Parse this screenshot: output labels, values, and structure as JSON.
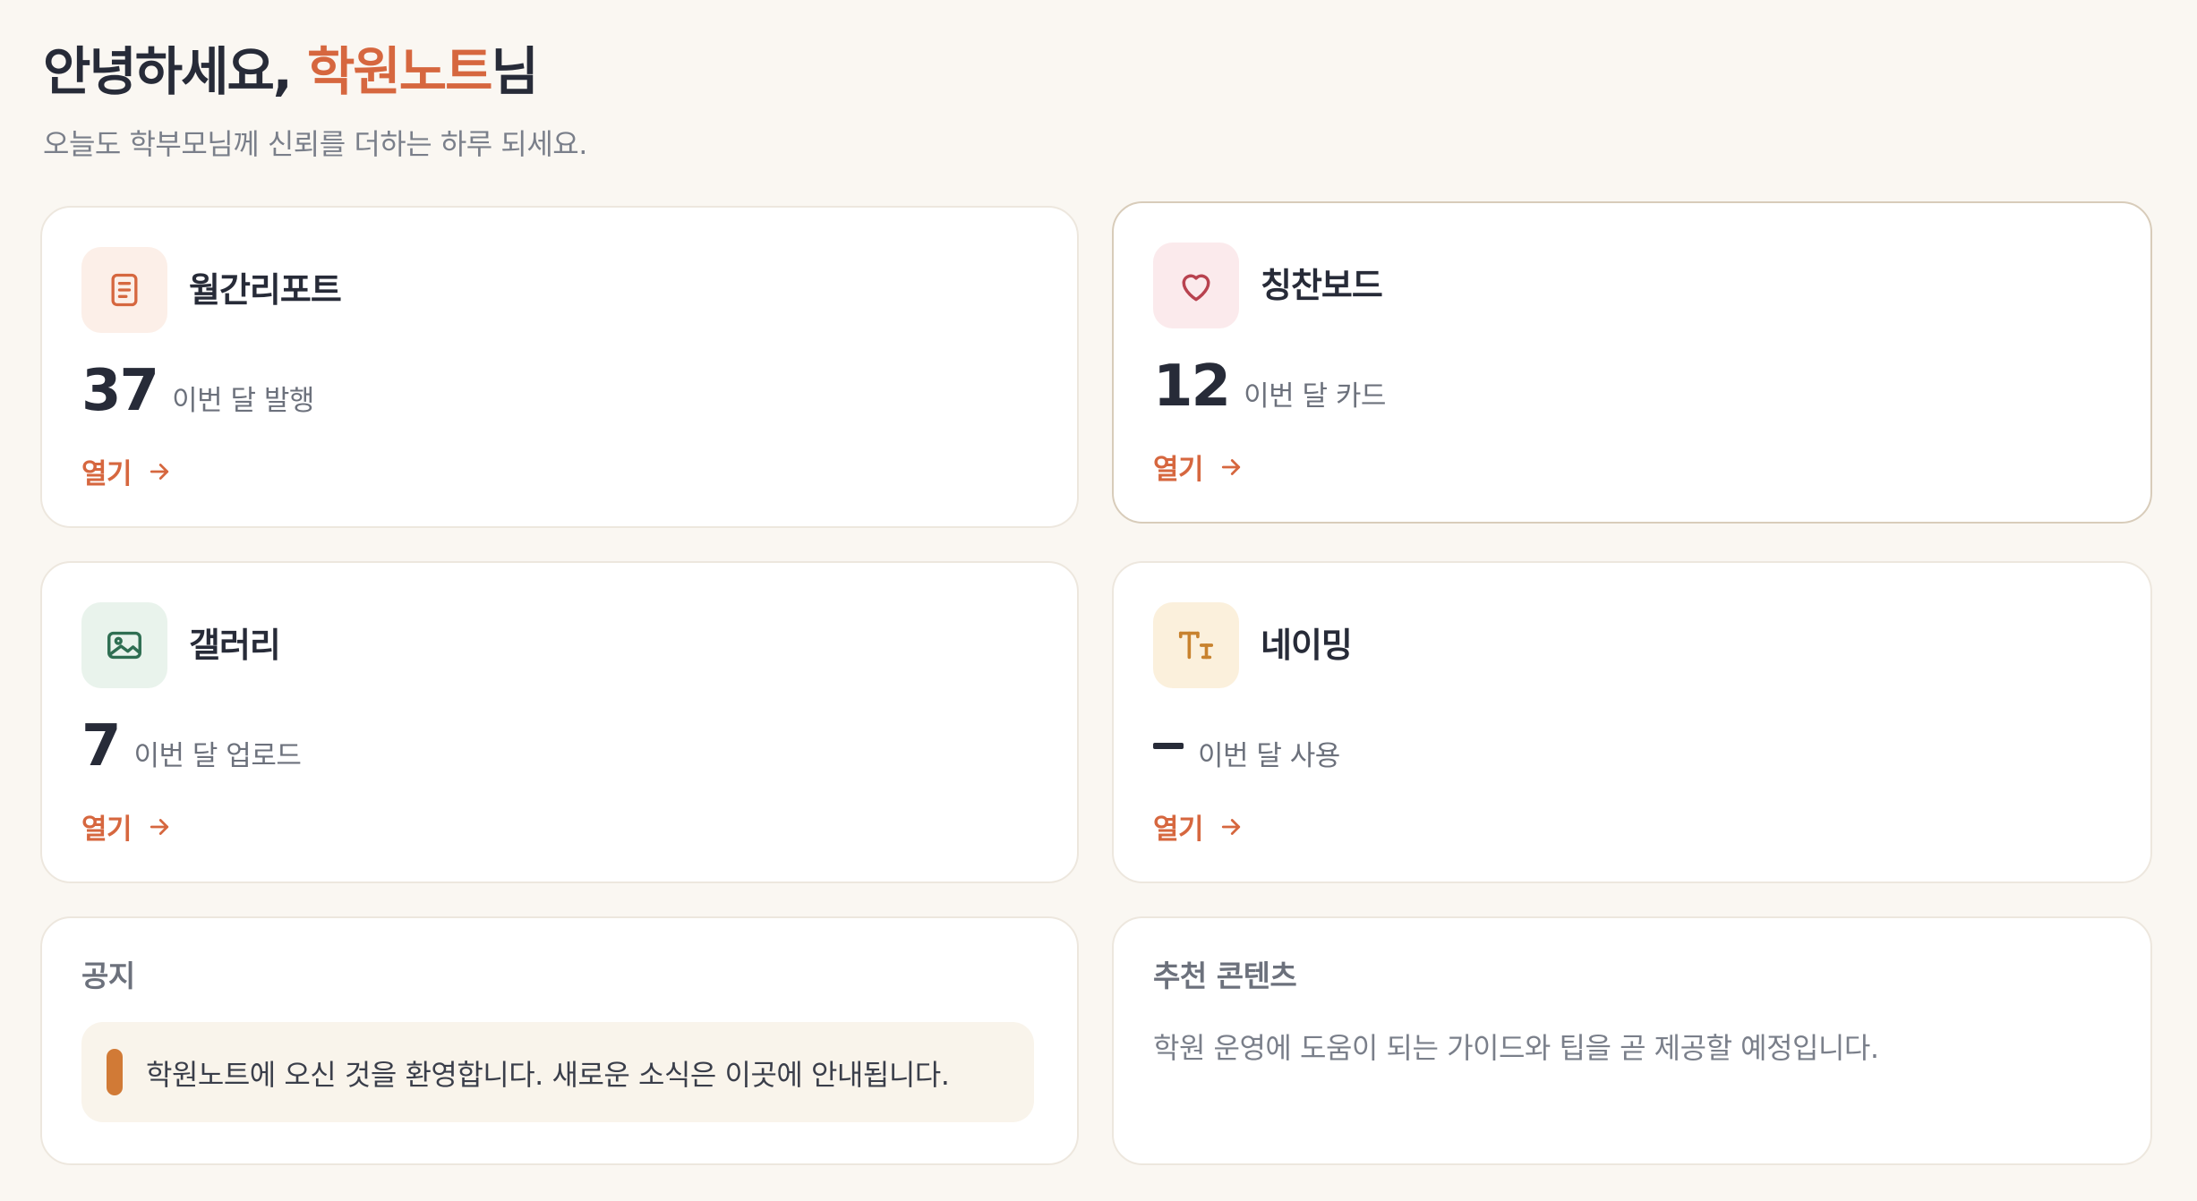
{
  "header": {
    "greeting_prefix": "안녕하세요, ",
    "academy_name": "학원노트",
    "greeting_suffix": "님",
    "subtitle": "오늘도 학부모님께 신뢰를 더하는 하루 되세요."
  },
  "cards": [
    {
      "title": "월간리포트",
      "icon": "document-icon",
      "stat_value": "37",
      "stat_caption": "이번 달 발행",
      "link_label": "열기",
      "icon_color": "#d6673f",
      "icon_bg": "#fcefe8"
    },
    {
      "title": "칭찬보드",
      "icon": "heart-icon",
      "stat_value": "12",
      "stat_caption": "이번 달 카드",
      "link_label": "열기",
      "icon_color": "#b8424f",
      "icon_bg": "#fbeaec"
    },
    {
      "title": "갤러리",
      "icon": "image-icon",
      "stat_value": "7",
      "stat_caption": "이번 달 업로드",
      "link_label": "열기",
      "icon_color": "#2f6e52",
      "icon_bg": "#e9f3ec"
    },
    {
      "title": "네이밍",
      "icon": "text-icon",
      "stat_value": "–",
      "stat_caption": "이번 달 사용",
      "link_label": "열기",
      "icon_color": "#c8822e",
      "icon_bg": "#fbf0dc"
    }
  ],
  "notice": {
    "title": "공지",
    "message": "학원노트에 오신 것을 환영합니다. 새로운 소식은 이곳에 안내됩니다."
  },
  "recommended": {
    "title": "추천 콘텐츠",
    "message": "학원 운영에 도움이 되는 가이드와 팁을 곧 제공할 예정입니다."
  },
  "colors": {
    "accent": "#d6673f",
    "background": "#faf7f2",
    "notice_bar": "#d17a36"
  }
}
